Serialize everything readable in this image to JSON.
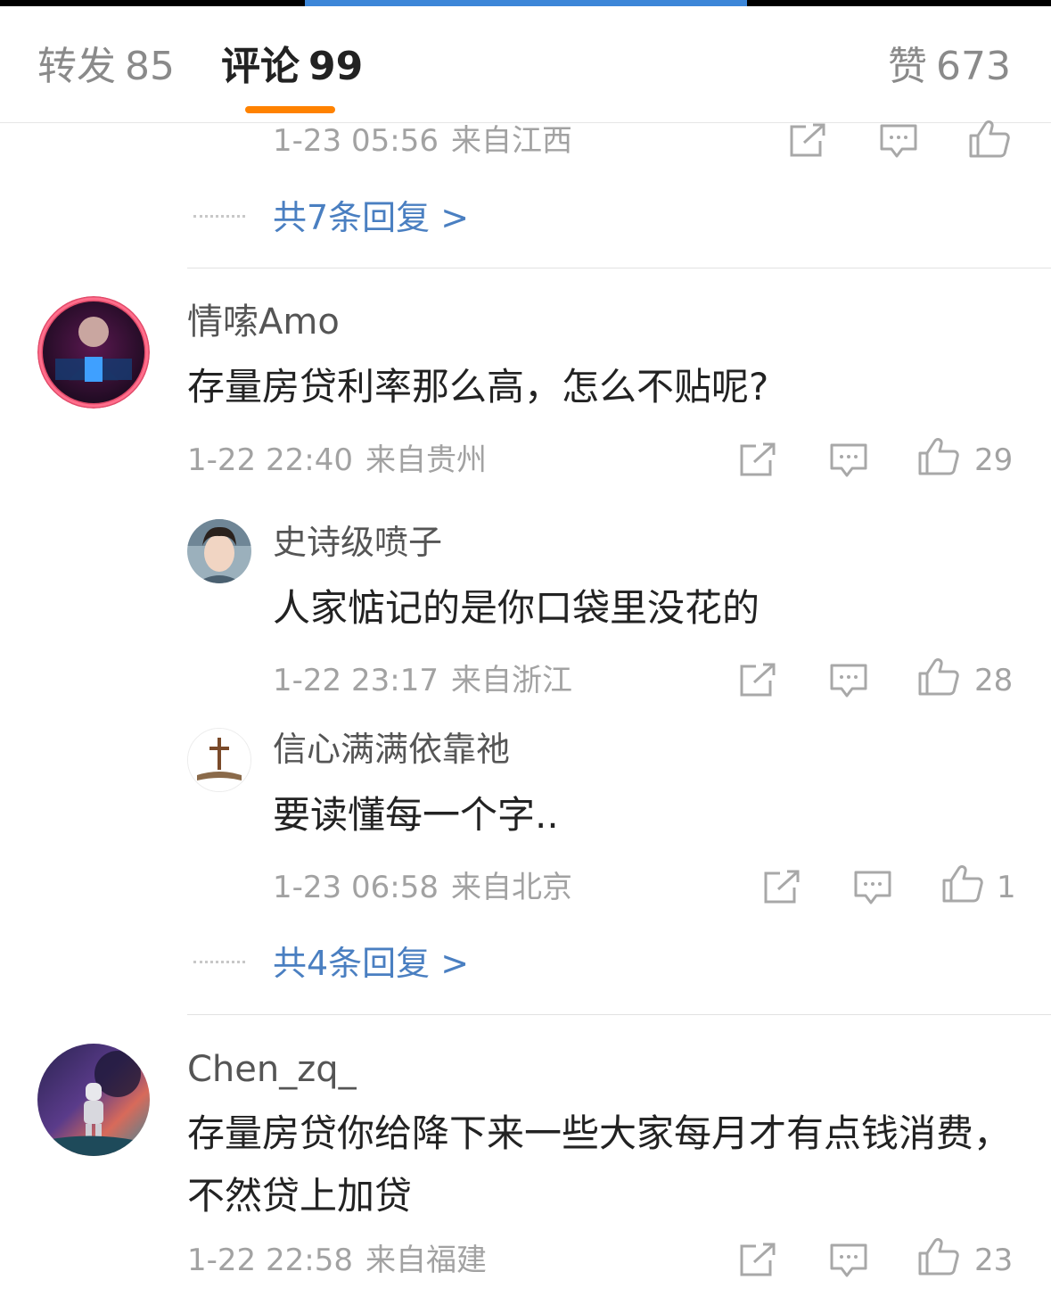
{
  "tabs": {
    "repost": {
      "label": "转发",
      "count": "85"
    },
    "comments": {
      "label": "评论",
      "count": "99"
    },
    "likes": {
      "label": "赞",
      "count": "673"
    }
  },
  "partial_comment": {
    "time": "1-23 05:56",
    "location": "来自江西",
    "more_replies": "共7条回复 >"
  },
  "comments": [
    {
      "username": "情嗦Amo",
      "text": "存量房贷利率那么高，怎么不贴呢?",
      "time": "1-22 22:40",
      "location": "来自贵州",
      "likes": "29",
      "replies": [
        {
          "username": "史诗级喷子",
          "text": "人家惦记的是你口袋里没花的",
          "time": "1-22 23:17",
          "location": "来自浙江",
          "likes": "28"
        },
        {
          "username": "信心满满依靠祂",
          "text": "要读懂每一个字..",
          "time": "1-23 06:58",
          "location": "来自北京",
          "likes": "1"
        }
      ],
      "more_replies": "共4条回复 >"
    },
    {
      "username": "Chen_zq_",
      "text": "存量房贷你给降下来一些大家每月才有点钱消费，不然贷上加贷",
      "time": "1-22 22:58",
      "location": "来自福建",
      "likes": "23"
    }
  ],
  "icons": {
    "repost": "share-icon",
    "comment": "comment-icon",
    "like": "thumbs-up-icon"
  },
  "colors": {
    "accent": "#ff8200",
    "link": "#4a7fc1",
    "meta": "#a2a2a2"
  }
}
